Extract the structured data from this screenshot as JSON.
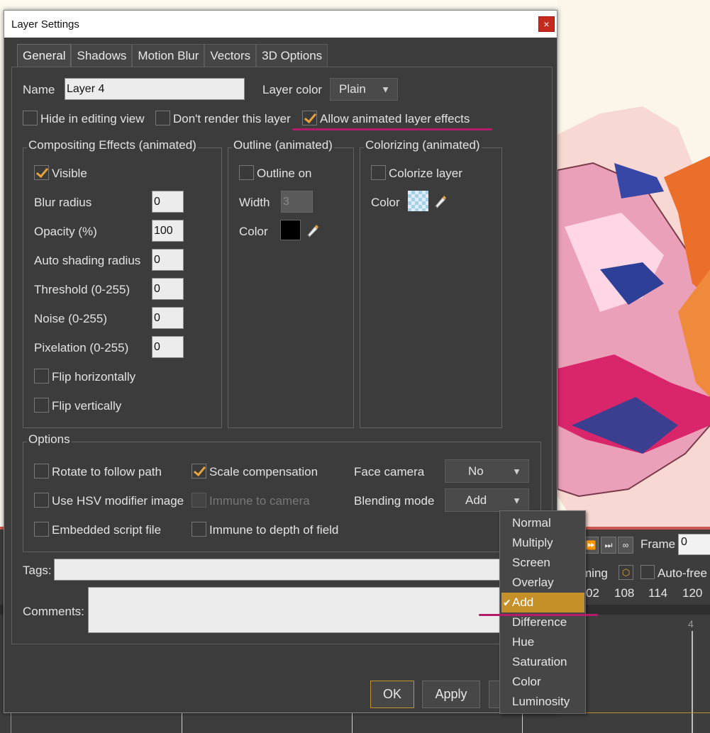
{
  "dialog": {
    "title": "Layer Settings",
    "close_label": "×",
    "tabs": [
      {
        "label": "General",
        "active": true
      },
      {
        "label": "Shadows"
      },
      {
        "label": "Motion Blur"
      },
      {
        "label": "Vectors"
      },
      {
        "label": "3D Options"
      }
    ]
  },
  "general": {
    "name_label": "Name",
    "name_value": "Layer 4",
    "layer_color_label": "Layer color",
    "layer_color_value": "Plain",
    "hide_label": "Hide in editing view",
    "dont_render_label": "Don't render this layer",
    "allow_anim_label": "Allow animated layer effects"
  },
  "compositing": {
    "title": "Compositing Effects (animated)",
    "visible_label": "Visible",
    "fields": [
      {
        "label": "Blur radius",
        "value": "0"
      },
      {
        "label": "Opacity (%)",
        "value": "100"
      },
      {
        "label": "Auto shading radius",
        "value": "0"
      },
      {
        "label": "Threshold (0-255)",
        "value": "0"
      },
      {
        "label": "Noise (0-255)",
        "value": "0"
      },
      {
        "label": "Pixelation (0-255)",
        "value": "0"
      }
    ],
    "flip_h_label": "Flip horizontally",
    "flip_v_label": "Flip vertically"
  },
  "outline": {
    "title": "Outline (animated)",
    "on_label": "Outline on",
    "width_label": "Width",
    "width_value": "3",
    "color_label": "Color"
  },
  "colorizing": {
    "title": "Colorizing (animated)",
    "colorize_label": "Colorize layer",
    "color_label": "Color"
  },
  "options": {
    "title": "Options",
    "rotate_label": "Rotate to follow path",
    "scale_label": "Scale compensation",
    "face_camera_label": "Face camera",
    "face_camera_value": "No",
    "hsv_label": "Use HSV modifier image",
    "immune_camera_label": "Immune to camera",
    "blending_label": "Blending mode",
    "blending_value": "Add",
    "embedded_label": "Embedded script file",
    "immune_dof_label": "Immune to depth of field"
  },
  "tags_label": "Tags:",
  "comments_label": "Comments:",
  "buttons": {
    "ok": "OK",
    "apply": "Apply"
  },
  "blend_menu": {
    "items": [
      "Normal",
      "Multiply",
      "Screen",
      "Overlay",
      "Add",
      "Difference",
      "Hue",
      "Saturation",
      "Color",
      "Luminosity"
    ],
    "selected": "Add",
    "check_glyph": "✔"
  },
  "timeline": {
    "frame_label": "Frame",
    "frame_value": "0",
    "timing_label": "ming",
    "auto_freeze_label": "Auto-free",
    "ruler_ticks": [
      "02",
      "108",
      "114",
      "120"
    ],
    "layer_marker": "4"
  },
  "colors": {
    "accent": "#c49027",
    "underline": "#b51b6b",
    "outline_swatch": "#000000"
  }
}
